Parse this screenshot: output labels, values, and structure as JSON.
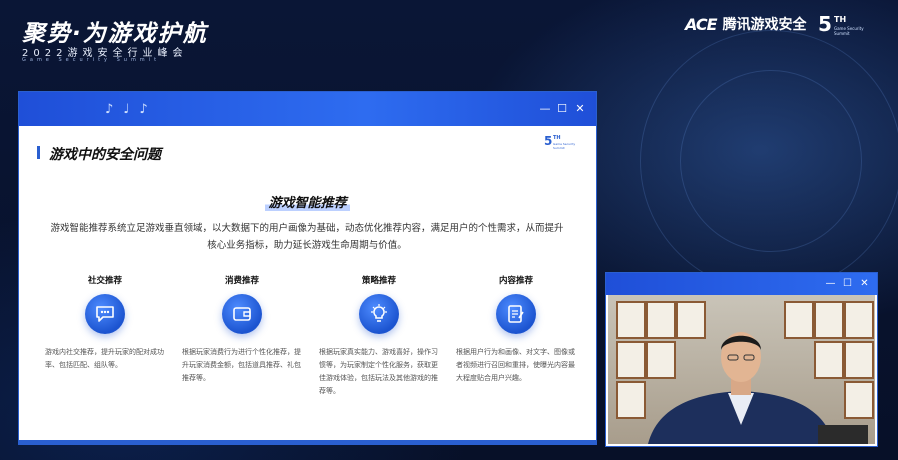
{
  "header": {
    "title": "聚势·为游戏护航",
    "subtitle": "2022游戏安全行业峰会",
    "subtitle_en": "Game Security Summit"
  },
  "brand": {
    "ace_logo": "ACE",
    "name": "腾讯游戏安全",
    "edition_number": "5",
    "edition_suffix": "TH",
    "edition_tagline": "Game Security Summit"
  },
  "main_window": {
    "section_title": "游戏中的安全问题",
    "feature_title": "游戏智能推荐",
    "description": "游戏智能推荐系统立足游戏垂直领域，以大数据下的用户画像为基础，动态优化推荐内容，满足用户的个性需求，从而提升核心业务指标，助力延长游戏生命周期与价值。",
    "cards": [
      {
        "title": "社交推荐",
        "icon": "chat-icon",
        "text": "游戏内社交推荐，提升玩家的配对成功率、包括匹配、组队等。"
      },
      {
        "title": "消费推荐",
        "icon": "wallet-icon",
        "text": "根据玩家消费行为进行个性化推荐，提升玩家消费金额，包括道具推荐、礼包推荐等。"
      },
      {
        "title": "策略推荐",
        "icon": "lightbulb-icon",
        "text": "根据玩家真实能力、游戏喜好，操作习惯等，为玩家制定个性化服务，获取更佳游戏体验，包括玩法及其他游戏的推荐等。"
      },
      {
        "title": "内容推荐",
        "icon": "document-edit-icon",
        "text": "根据用户行为和画像、对文字、图像或者视频进行召回和重排，使曝光内容最大程度贴合用户兴趣。"
      }
    ],
    "controls": {
      "minimize": "—",
      "maximize": "☐",
      "close": "✕"
    }
  },
  "video_window": {
    "controls": {
      "minimize": "—",
      "maximize": "☐",
      "close": "✕"
    }
  },
  "colors": {
    "accent": "#2a5fd0",
    "background": "#07122e"
  }
}
